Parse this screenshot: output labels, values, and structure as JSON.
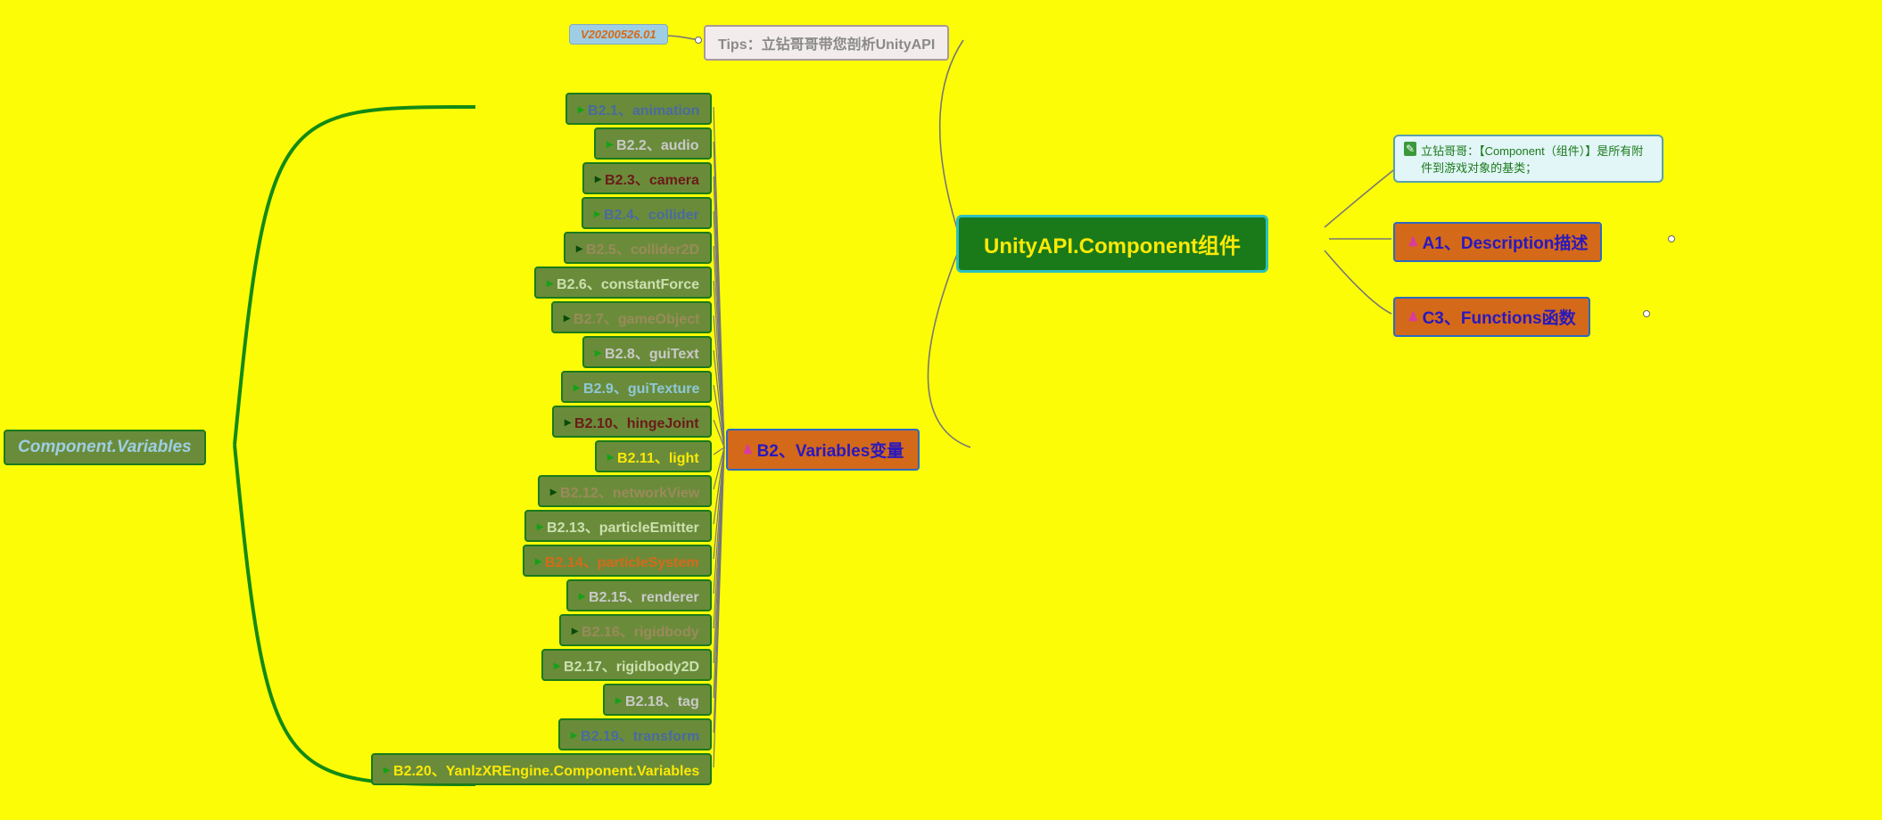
{
  "version": {
    "label": "V20200526.01"
  },
  "tips": {
    "label": "Tips：立钻哥哥带您剖析UnityAPI"
  },
  "root": {
    "title": "UnityAPI.Component组件",
    "note": "立钻哥哥：【Component（组件）】是所有附件到游戏对象的基类；"
  },
  "right": {
    "a1": "A1、Description描述",
    "c3": "C3、Functions函数"
  },
  "b2": {
    "title": "B2、Variables变量",
    "caption": "Component.Variables",
    "items": [
      "B2.1、animation",
      "B2.2、audio",
      "B2.3、camera",
      "B2.4、collider",
      "B2.5、collider2D",
      "B2.6、constantForce",
      "B2.7、gameObject",
      "B2.8、guiText",
      "B2.9、guiTexture",
      "B2.10、hingeJoint",
      "B2.11、light",
      "B2.12、networkView",
      "B2.13、particleEmitter",
      "B2.14、particleSystem",
      "B2.15、renderer",
      "B2.16、rigidbody",
      "B2.17、rigidbody2D",
      "B2.18、tag",
      "B2.19、transform",
      "B2.20、YanlzXREngine.Component.Variables"
    ]
  }
}
